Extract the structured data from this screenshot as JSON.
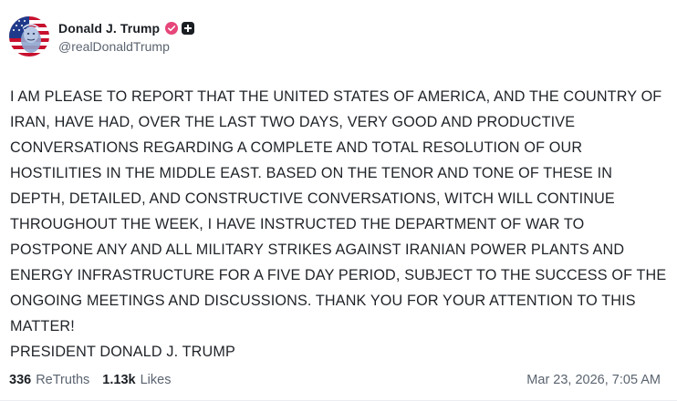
{
  "author": {
    "display_name": "Donald J. Trump",
    "handle": "@realDonaldTrump",
    "avatar_icon": "avatar-flag-portrait",
    "verified_icon": "verified-badge-icon",
    "verified_color": "#e6467a",
    "plus_icon": "plus-badge-icon"
  },
  "post": {
    "text": "I AM PLEASE TO REPORT THAT THE UNITED STATES OF AMERICA, AND THE COUNTRY OF IRAN, HAVE HAD, OVER THE LAST TWO DAYS, VERY GOOD AND PRODUCTIVE CONVERSATIONS REGARDING A COMPLETE AND TOTAL RESOLUTION OF OUR HOSTILITIES IN THE MIDDLE EAST. BASED ON THE TENOR AND TONE OF THESE IN DEPTH, DETAILED, AND CONSTRUCTIVE CONVERSATIONS, WITCH WILL CONTINUE THROUGHOUT THE WEEK, I HAVE INSTRUCTED THE DEPARTMENT OF WAR TO POSTPONE ANY AND ALL MILITARY STRIKES AGAINST IRANIAN POWER PLANTS AND ENERGY INFRASTRUCTURE FOR A FIVE DAY PERIOD, SUBJECT TO THE SUCCESS OF THE ONGOING MEETINGS AND DISCUSSIONS. THANK YOU FOR YOUR ATTENTION TO THIS MATTER!\nPRESIDENT DONALD J. TRUMP"
  },
  "stats": {
    "retruths_count": "336",
    "retruths_label": "ReTruths",
    "likes_count": "1.13k",
    "likes_label": "Likes"
  },
  "timestamp": "Mar 23, 2026, 7:05 AM"
}
